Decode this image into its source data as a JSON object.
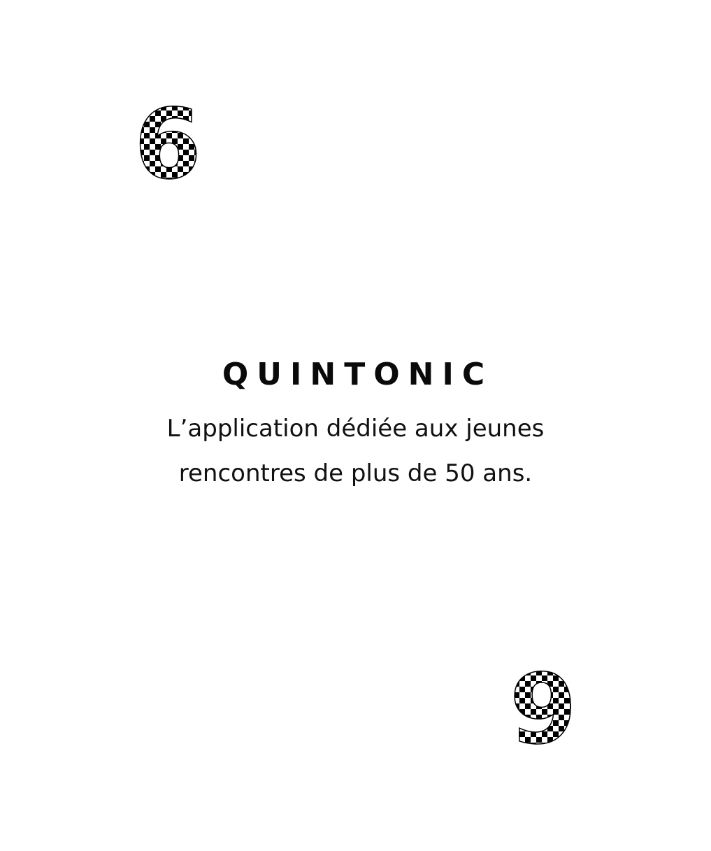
{
  "brand": {
    "title": "QUINTONIC"
  },
  "tagline": {
    "line1": "L’application dédiée aux jeunes",
    "line2": "rencontres de plus de 50 ans."
  },
  "decorations": {
    "top_digit": "6",
    "bottom_digit": "9",
    "pattern": "checkerboard",
    "pattern_colors": [
      "#000000",
      "#ffffff"
    ]
  },
  "colors": {
    "background": "#ffffff",
    "text": "#111111"
  }
}
